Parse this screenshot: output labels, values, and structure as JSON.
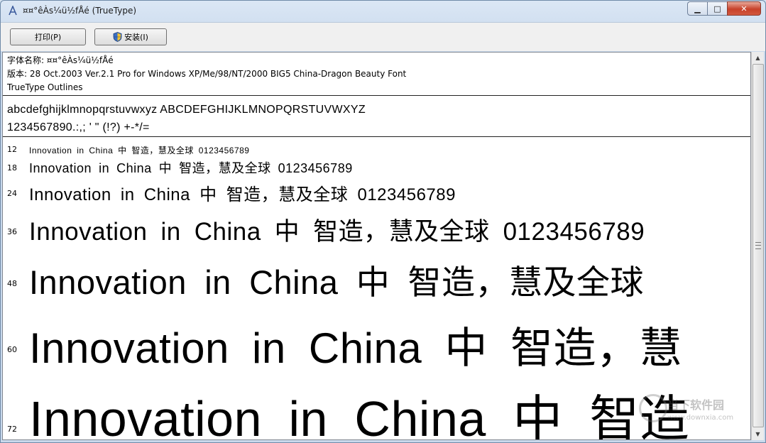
{
  "window": {
    "title": "¤¤°êÀs¼ü½fÅé (TrueType)",
    "app_icon": "font-icon",
    "minimize_glyph": "▁",
    "maximize_glyph": "□",
    "close_glyph": "✕"
  },
  "toolbar": {
    "print_label": "打印(P)",
    "install_label": "安装(I)",
    "install_icon": "uac-shield-icon"
  },
  "info": {
    "font_name": "字体名称: ¤¤°êÀs¼ü½fÅé",
    "version": "版本: 28 Oct.2003 Ver.2.1 Pro for Windows XP/Me/98/NT/2000 BIG5 China-Dragon Beauty Font",
    "outline_type": "TrueType Outlines"
  },
  "charset": {
    "letters": "abcdefghijklmnopqrstuvwxyz  ABCDEFGHIJKLMNOPQRSTUVWXYZ",
    "digits_symbols": "1234567890.:,; ' \" (!?)  +-*/="
  },
  "samples": [
    {
      "size": "12",
      "text": "Innovation in China 中 智造，慧及全球 0123456789"
    },
    {
      "size": "18",
      "text": "Innovation in China 中 智造，慧及全球 0123456789"
    },
    {
      "size": "24",
      "text": "Innovation in China 中 智造，慧及全球 0123456789"
    },
    {
      "size": "36",
      "text": "Innovation in China 中 智造，慧及全球 0123456789"
    },
    {
      "size": "48",
      "text": "Innovation in China 中 智造，慧及全球"
    },
    {
      "size": "60",
      "text": "Innovation in China 中 智造，慧"
    },
    {
      "size": "72",
      "text": "Innovation in China 中 智造"
    }
  ],
  "watermark": {
    "line1": "当下软件园",
    "line2": "www.downxia.com"
  }
}
